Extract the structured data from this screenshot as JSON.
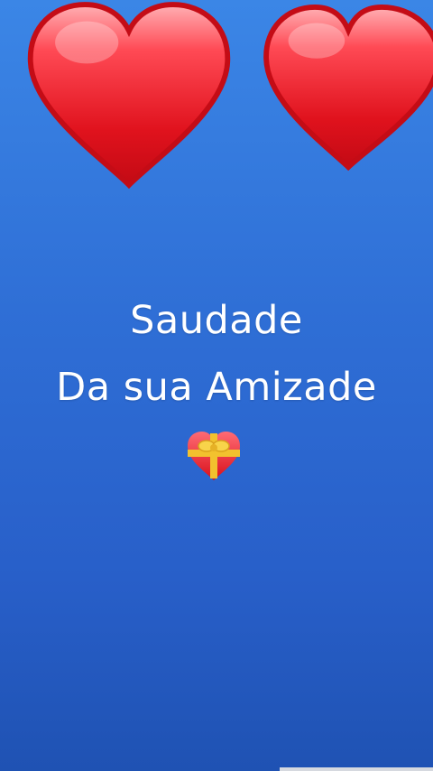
{
  "story": {
    "line1": "Saudade",
    "line2": "Da sua Amizade",
    "emoji": "gift-heart-icon"
  },
  "colors": {
    "background_top": "#3b86e6",
    "background_bottom": "#1f52b3",
    "heart_red": "#e0131e",
    "text": "#ffffff"
  },
  "icons": [
    "heart-icon",
    "heart-icon",
    "gift-heart-icon"
  ]
}
